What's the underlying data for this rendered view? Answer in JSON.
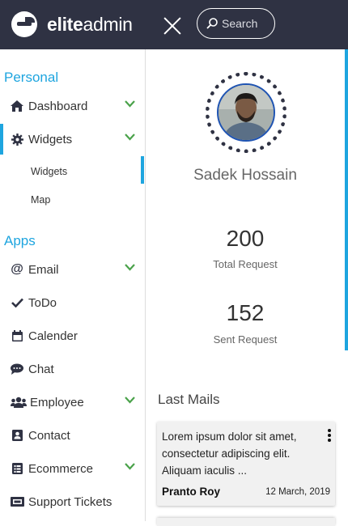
{
  "header": {
    "logo_bold": "elite",
    "logo_light": "admin",
    "search_placeholder": "Search"
  },
  "sidebar": {
    "sections": [
      "Personal",
      "Apps"
    ],
    "personal_items": [
      {
        "label": "Dashboard",
        "icon": "home-icon",
        "has_chevron": true
      },
      {
        "label": "Widgets",
        "icon": "gear-icon",
        "has_chevron": true,
        "active": true
      }
    ],
    "widgets_subitems": [
      "Widgets",
      "Map"
    ],
    "app_items": [
      {
        "label": "Email",
        "icon": "at-icon",
        "has_chevron": true
      },
      {
        "label": "ToDo",
        "icon": "check-icon",
        "has_chevron": false
      },
      {
        "label": "Calender",
        "icon": "calendar-icon",
        "has_chevron": false
      },
      {
        "label": "Chat",
        "icon": "chat-icon",
        "has_chevron": false
      },
      {
        "label": "Employee",
        "icon": "users-icon",
        "has_chevron": true
      },
      {
        "label": "Contact",
        "icon": "contact-card-icon",
        "has_chevron": false
      },
      {
        "label": "Ecommerce",
        "icon": "list-icon",
        "has_chevron": true
      },
      {
        "label": "Support Tickets",
        "icon": "ticket-icon",
        "has_chevron": false
      }
    ]
  },
  "profile": {
    "name": "Sadek Hossain",
    "stats": [
      {
        "value": "200",
        "label": "Total Request"
      },
      {
        "value": "152",
        "label": "Sent Request"
      }
    ]
  },
  "last_mails": {
    "title": "Last Mails",
    "items": [
      {
        "text": "Lorem ipsum dolor sit amet, consectetur adipiscing elit. Aliquam iaculis ...",
        "author": "Pranto Roy",
        "date": "12 March, 2019"
      }
    ]
  },
  "colors": {
    "topbar": "#2f3243",
    "accent": "#1ea5df",
    "chevron": "#4aa24a"
  }
}
